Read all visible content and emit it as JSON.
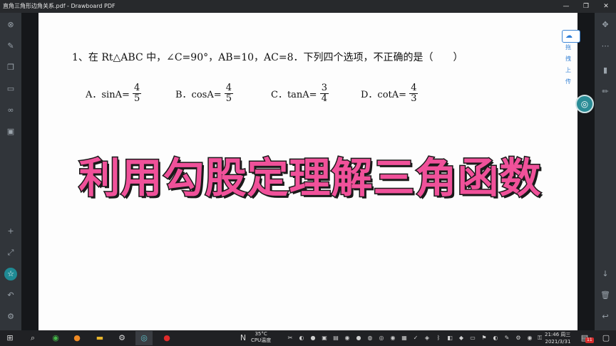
{
  "window": {
    "title": "直角三角形边角关系.pdf - Drawboard PDF",
    "minimize": "—",
    "maximize": "❐",
    "close": "✕"
  },
  "question": {
    "text": "1、在 Rt△ABC 中，∠C=90°，AB=10，AC=8．下列四个选项，不正确的是（　　）",
    "options": [
      {
        "label": "A．sinA=",
        "num": "4",
        "den": "5"
      },
      {
        "label": "B．cosA=",
        "num": "4",
        "den": "5"
      },
      {
        "label": "C．tanA=",
        "num": "3",
        "den": "4"
      },
      {
        "label": "D．cotA=",
        "num": "4",
        "den": "3"
      }
    ]
  },
  "banner": "利用勾股定理解三角函数",
  "upload_button": "拖拽上传",
  "taskbar": {
    "temperature": "35°C",
    "temperature_label": "CPU温度",
    "time": "21:46 周三",
    "date": "2021/3/31",
    "badge": "11"
  },
  "icons": {
    "left": [
      "close-circle-icon",
      "pen-icon",
      "copy-icon",
      "keyboard-icon",
      "binoculars-icon",
      "save-icon",
      "add-layer-icon",
      "expand-icon",
      "star-icon",
      "undo-icon",
      "settings-icon"
    ],
    "right": [
      "move-icon",
      "more-icon",
      "highlighter-icon",
      "pencil-icon",
      "arrow-down-icon",
      "trash-icon",
      "back-icon"
    ]
  },
  "colors": {
    "banner_fill": "#f0519a",
    "accent": "#2a8c96",
    "upload_blue": "#3d86d6"
  }
}
